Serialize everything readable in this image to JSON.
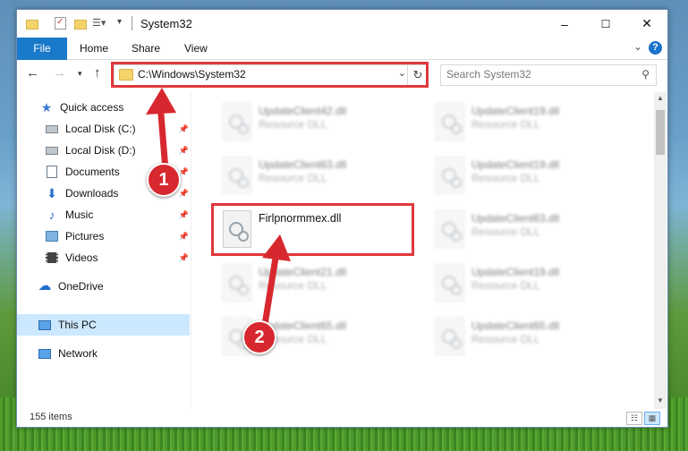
{
  "window": {
    "title": "System32",
    "controls": {
      "minimize": "–",
      "maximize": "☐",
      "close": "✕"
    }
  },
  "ribbon": {
    "tabs": [
      "File",
      "Home",
      "Share",
      "View"
    ],
    "help": "?"
  },
  "navbar": {
    "address": "C:\\Windows\\System32",
    "search_placeholder": "Search System32"
  },
  "sidebar": {
    "items": [
      {
        "label": "Quick access",
        "icon": "star-icon",
        "pinned": false
      },
      {
        "label": "Local Disk (C:)",
        "icon": "drive-icon",
        "pinned": true
      },
      {
        "label": "Local Disk (D:)",
        "icon": "drive-icon",
        "pinned": true
      },
      {
        "label": "Documents",
        "icon": "documents-icon",
        "pinned": true
      },
      {
        "label": "Downloads",
        "icon": "download-icon",
        "pinned": true
      },
      {
        "label": "Music",
        "icon": "music-icon",
        "pinned": true
      },
      {
        "label": "Pictures",
        "icon": "pictures-icon",
        "pinned": true
      },
      {
        "label": "Videos",
        "icon": "videos-icon",
        "pinned": true
      },
      {
        "label": "OneDrive",
        "icon": "cloud-icon",
        "pinned": false
      },
      {
        "label": "This PC",
        "icon": "pc-icon",
        "pinned": false,
        "selected": true
      },
      {
        "label": "Network",
        "icon": "network-icon",
        "pinned": false
      }
    ]
  },
  "files": [
    {
      "name": "UpdateClient42.dll",
      "type": "Resource DLL",
      "blurred": true
    },
    {
      "name": "UpdateClient19.dll",
      "type": "Resource DLL",
      "blurred": true
    },
    {
      "name": "UpdateClient63.dll",
      "type": "Resource DLL",
      "blurred": true
    },
    {
      "name": "UpdateClient19.dll",
      "type": "Resource DLL",
      "blurred": true
    },
    {
      "name": "Firlpnormmex.dll",
      "type": "",
      "blurred": false
    },
    {
      "name": "UpdateClient63.dll",
      "type": "Resource DLL",
      "blurred": true
    },
    {
      "name": "UpdateClient21.dll",
      "type": "Resource DLL",
      "blurred": true
    },
    {
      "name": "UpdateClient19.dll",
      "type": "Resource DLL",
      "blurred": true
    },
    {
      "name": "UpdateClient65.dll",
      "type": "Resource DLL",
      "blurred": true
    },
    {
      "name": "UpdateClient65.dll",
      "type": "Resource DLL",
      "blurred": true
    }
  ],
  "status": {
    "items_count": "155 items"
  },
  "annotations": {
    "step1": "1",
    "step2": "2",
    "color": "#d7282f"
  }
}
